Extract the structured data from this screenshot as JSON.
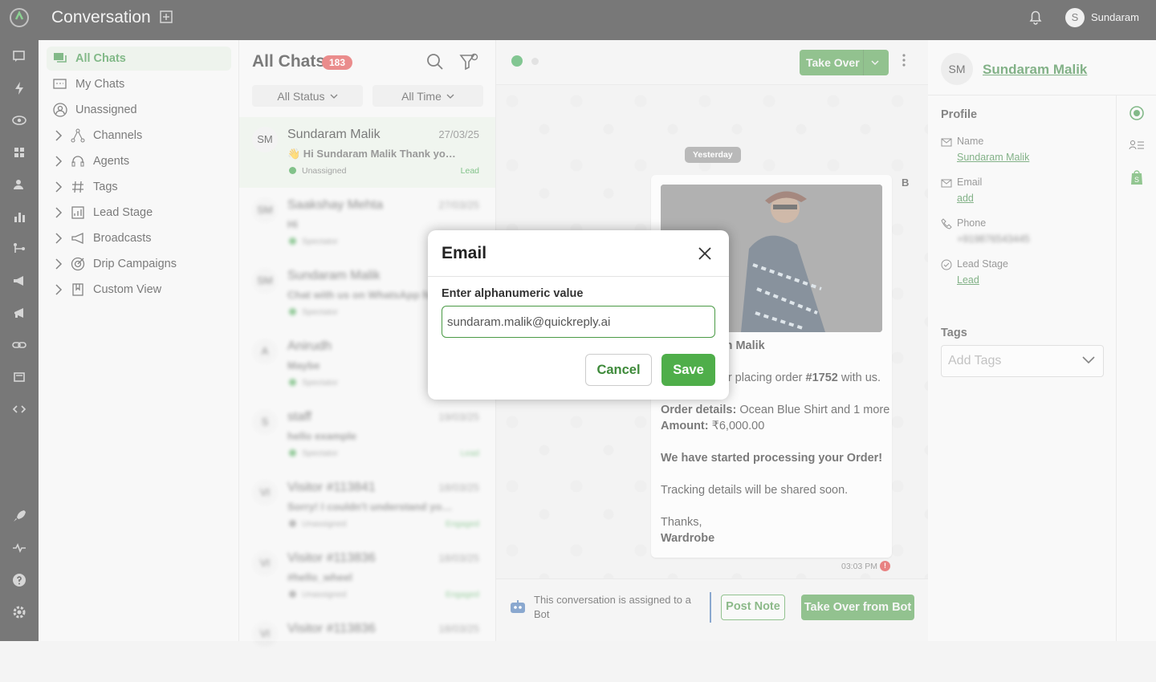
{
  "app": {
    "title": "Conversation",
    "user_initial": "S",
    "user_name": "Sundaram"
  },
  "sidebar": {
    "items": [
      {
        "label": "All Chats",
        "icon": "chat-bubbles-icon",
        "active": true
      },
      {
        "label": "My Chats",
        "icon": "chat-icon"
      },
      {
        "label": "Unassigned",
        "icon": "user-circle-icon"
      },
      {
        "label": "Channels",
        "icon": "channels-icon",
        "expandable": true
      },
      {
        "label": "Agents",
        "icon": "headset-icon",
        "expandable": true
      },
      {
        "label": "Tags",
        "icon": "hash-icon",
        "expandable": true
      },
      {
        "label": "Lead Stage",
        "icon": "lead-stage-icon",
        "expandable": true
      },
      {
        "label": "Broadcasts",
        "icon": "megaphone-icon",
        "expandable": true
      },
      {
        "label": "Drip Campaigns",
        "icon": "target-icon",
        "expandable": true
      },
      {
        "label": "Custom View",
        "icon": "bookmark-icon",
        "expandable": true
      }
    ]
  },
  "chatlist": {
    "title": "All Chats",
    "count": "183",
    "status_filter": "All Status",
    "time_filter": "All Time",
    "items": [
      {
        "initials": "SM",
        "name": "Sundaram Malik",
        "date": "27/03/25",
        "message": "👋 Hi Sundaram Malik Thank you for placing order",
        "status": "Unassigned",
        "tag": "Lead",
        "selected": true
      },
      {
        "initials": "SM",
        "name": "Saakshay Mehta",
        "date": "27/03/25",
        "message": "Hi",
        "status": "Spectator",
        "tag": ""
      },
      {
        "initials": "SM",
        "name": "Sundaram Malik",
        "date": "",
        "message": "Chat with us on WhatsApp for help",
        "status": "Spectator",
        "tag": ""
      },
      {
        "initials": "A",
        "name": "Anirudh",
        "date": "",
        "message": "Maybe",
        "status": "Spectator",
        "tag": ""
      },
      {
        "initials": "S",
        "name": "staff",
        "date": "19/03/25",
        "message": "hello example",
        "status": "Spectator",
        "tag": "Lead"
      },
      {
        "initials": "VI",
        "name": "Visitor #113841",
        "date": "18/03/25",
        "message": "Sorry! I couldn't understand your query",
        "status": "Unassigned",
        "tag": "Engaged"
      },
      {
        "initials": "VI",
        "name": "Visitor #113836",
        "date": "18/03/25",
        "message": "#hello_wheel",
        "status": "Unassigned",
        "tag": "Engaged"
      },
      {
        "initials": "VI",
        "name": "Visitor #113836",
        "date": "18/03/25",
        "message": "",
        "status": "",
        "tag": ""
      }
    ]
  },
  "chat": {
    "take_over_label": "Take Over",
    "date_label": "Yesterday",
    "bot_badge": "B",
    "message": {
      "greeting": "Hi Sundaram Malik",
      "line1_prefix": "Thank you for placing order ",
      "order_no": "#1752",
      "line1_suffix": " with us.",
      "order_details_label": "Order details:",
      "order_details": "Ocean Blue Shirt and 1 more",
      "amount_label": "Amount:",
      "amount": "₹6,000.00",
      "processing": "We have started processing your Order!",
      "tracking": "Tracking details will be shared soon.",
      "thanks": "Thanks,",
      "sign": "Wardrobe",
      "time": "03:03 PM",
      "error_mark": "!"
    },
    "footer_text": "This conversation is assigned to a Bot",
    "post_note_label": "Post Note",
    "take_over_bot_label": "Take Over from Bot"
  },
  "profile": {
    "initials": "SM",
    "name": "Sundaram Malik",
    "section": "Profile",
    "fields": {
      "name_label": "Name",
      "name_value": "Sundaram Malik",
      "email_label": "Email",
      "email_value": "add",
      "phone_label": "Phone",
      "phone_value": "+919876543445",
      "lead_label": "Lead Stage",
      "lead_value": "Lead"
    },
    "tags_label": "Tags",
    "tags_placeholder": "Add Tags"
  },
  "modal": {
    "title": "Email",
    "field_label": "Enter alphanumeric value",
    "input_value": "sundaram.malik@quickreply.ai",
    "cancel_label": "Cancel",
    "save_label": "Save"
  },
  "colors": {
    "accent": "#4a9a45",
    "badge": "#dd4040",
    "topbar": "#1e1e1e"
  }
}
